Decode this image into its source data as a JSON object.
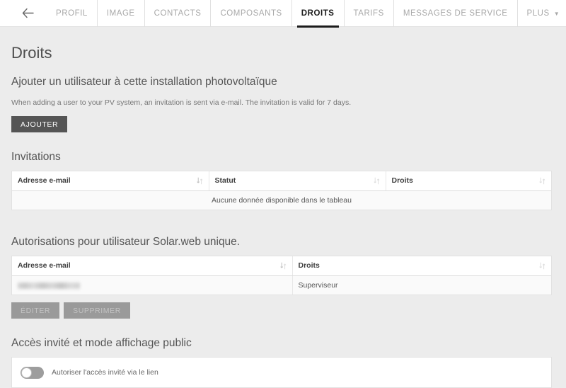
{
  "nav": {
    "back_icon": "arrow-left-icon",
    "items": [
      {
        "label": "PROFIL",
        "active": false
      },
      {
        "label": "IMAGE",
        "active": false
      },
      {
        "label": "CONTACTS",
        "active": false
      },
      {
        "label": "COMPOSANTS",
        "active": false
      },
      {
        "label": "DROITS",
        "active": true
      },
      {
        "label": "TARIFS",
        "active": false
      },
      {
        "label": "MESSAGES DE SERVICE",
        "active": false
      },
      {
        "label": "PLUS",
        "active": false,
        "caret": "▼"
      }
    ]
  },
  "page": {
    "title": "Droits",
    "add_user_heading": "Ajouter un utilisateur à cette installation photovoltaïque",
    "add_user_help": "When adding a user to your PV system, an invitation is sent via e-mail. The invitation is valid for 7 days.",
    "add_button": "AJOUTER"
  },
  "invitations": {
    "heading": "Invitations",
    "columns": [
      "Adresse e-mail",
      "Statut",
      "Droits"
    ],
    "empty_message": "Aucune donnée disponible dans le tableau",
    "rows": []
  },
  "authorizations": {
    "heading": "Autorisations pour utilisateur Solar.web unique.",
    "columns": [
      "Adresse e-mail",
      "Droits"
    ],
    "rows": [
      {
        "email": "",
        "email_redacted": true,
        "rights": "Superviseur"
      }
    ],
    "edit_button": "ÉDITER",
    "delete_button": "SUPPRIMER"
  },
  "guest_access": {
    "heading": "Accès invité et mode affichage public",
    "toggle_label": "Autoriser l'accès invité via le lien",
    "toggle_state": "off"
  },
  "colors": {
    "page_background": "#ececec",
    "panel_background": "#ffffff",
    "primary_button": "#555555",
    "disabled_button": "#9a9a9a",
    "active_tab": "#1c1c1c",
    "inactive_tab": "#a8a8a8"
  }
}
